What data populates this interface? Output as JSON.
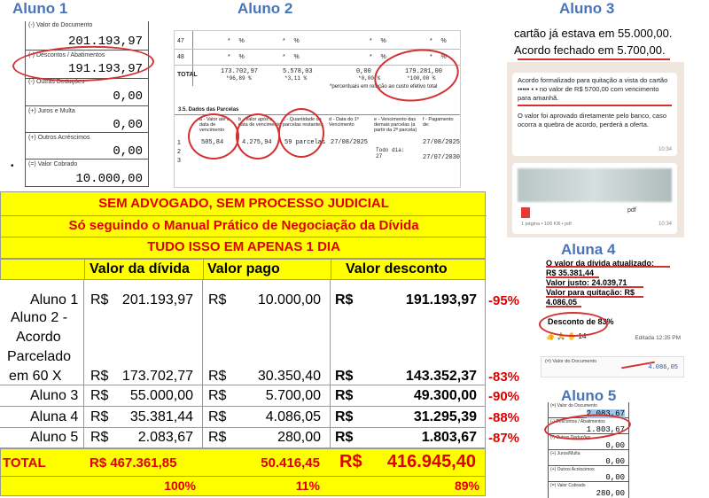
{
  "captions": {
    "aluno1": "Aluno 1",
    "aluno2": "Aluno 2",
    "aluno3": "Aluno 3",
    "aluna4": "Aluna 4",
    "aluno5": "Aluno 5"
  },
  "doc1": {
    "row0_label": "(-) Valor do Documento",
    "row0_value": "201.193,97",
    "row1_label": "(-) Descontos / Abatimentos",
    "row1_value": "191.193,97",
    "row2_label": "(-) Outras Deduções",
    "row2_value": "0,00",
    "row3_label": "(+) Juros e Multa",
    "row3_value": "0,00",
    "row4_label": "(+) Outros Acréscimos",
    "row4_value": "0,00",
    "row5_label": "(=) Valor Cobrado",
    "row5_value": "10.000,00"
  },
  "doc2": {
    "r47": "47",
    "r48": "48",
    "total_label": "TOTAL",
    "total_v1": "173.702,97",
    "total_p1": "*96,89 %",
    "total_v2": "5.578,03",
    "total_p2": "*3,11 %",
    "total_v3": "0,00",
    "total_p3": "*0,00 %",
    "total_v4": "179.281,00",
    "total_p4": "*100,00 %",
    "note": "*percentuais em relação ao custo efetivo total",
    "section": "3.5. Dados das Parcelas",
    "col_a": "a - Valor até a data de vencimento",
    "col_b": "b - Valor após a data de vencimento",
    "col_c": "c - Quantidade de parcelas restantes:",
    "col_d": "d - Data do 1º Vencimento",
    "col_e": "e - Vencimento das demais parcelas (a partir da 2ª parcela)",
    "col_f": "f - Pagamento de:",
    "row_num1": "1",
    "row_num2": "2",
    "row_num3": "3",
    "val_a": "505,84",
    "val_b": "4.275,94",
    "val_c": "59 parcelas",
    "val_d": "27/08/2025",
    "val_e": "Todo dia: 27",
    "val_f1": "27/08/2025",
    "val_f2": "27/07/2030"
  },
  "chat3": {
    "top_line1": "cartão já estava em 55.000,00.",
    "top_line2": "Acordo fechado em 5.700,00.",
    "msg1": "Acordo formalizado para quitação a vista do cartão ▪▪▪▪▪ ▪ ▪ no valor de R$ 5700,00 com vencimento para amanhã.",
    "time1": "10:34",
    "msg2": "O valor foi aprovado diretamente pelo banco, caso ocorra a quebra de acordo, perderá a oferta.",
    "time2": "10:34",
    "file_ext": "pdf",
    "file_info": "1 página • 106 KB • pdf",
    "time3": "10:34"
  },
  "chat4": {
    "line1": "O valor da dívida atualizado:",
    "line2": "R$ 35.381,44",
    "line3": "Valor justo: 24.039,71",
    "line4": "Valor para quitação: R$",
    "line5": "4.086,05",
    "line6": "Desconto de 83%",
    "reactions": "👍 🙏 ✋ 14",
    "edited": "Editada 12:35 PM",
    "doc_label": "(=) Valor do Documento",
    "doc_value": "4.086,05"
  },
  "doc5": {
    "r0_label": "(=) Valor do Documento",
    "r0_value": "2.083,67",
    "r1_label": "(-) Descontos / Abatimentos",
    "r1_value": "1.803,67",
    "r2_label": "(-) Outras Deduções",
    "r2_value": "0,00",
    "r3_label": "(+) Juros/Multa",
    "r3_value": "0,00",
    "r4_label": "(+) Outros Acréscimos",
    "r4_value": "0,00",
    "r5_label": "(=) Valor Cobrado",
    "r5_value": "280,00"
  },
  "banner": {
    "line1": "SEM ADVOGADO, SEM PROCESSO JUDICIAL",
    "line2": "Só seguindo o Manual Prático de Negociação da Dívida",
    "line3": "TUDO ISSO EM APENAS 1 DIA"
  },
  "table": {
    "headers": [
      "Valor da dívida",
      "Valor pago",
      "Valor desconto"
    ],
    "currency": "R$",
    "rows": [
      {
        "name": "Aluno 1",
        "debt": "201.193,97",
        "paid": "10.000,00",
        "discount": "191.193,97",
        "pct": "-95%"
      },
      {
        "name": "Aluno 2 - Acordo Parcelado em 60 X",
        "name_l1": "Aluno 2 -",
        "name_l2": "Acordo",
        "name_l3": "Parcelado",
        "name_l4": "em 60 X",
        "debt": "173.702,77",
        "paid": "30.350,40",
        "discount": "143.352,37",
        "pct": "-83%"
      },
      {
        "name": "Aluno 3",
        "debt": "55.000,00",
        "paid": "5.700,00",
        "discount": "49.300,00",
        "pct": "-90%"
      },
      {
        "name": "Aluna 4",
        "debt": "35.381,44",
        "paid": "4.086,05",
        "discount": "31.295,39",
        "pct": "-88%"
      },
      {
        "name": "Aluno 5",
        "debt": "2.083,67",
        "paid": "280,00",
        "discount": "1.803,67",
        "pct": "-87%"
      }
    ],
    "total": {
      "label": "TOTAL",
      "debt": "R$ 467.361,85",
      "paid": "50.416,45",
      "disc_currency": "R$",
      "discount": "416.945,40"
    },
    "percents": {
      "debt": "100%",
      "paid": "11%",
      "discount": "89%"
    }
  },
  "colors": {
    "accent_red": "#e00000",
    "highlight_yellow": "#ffff00",
    "caption_blue": "#4a74b8"
  }
}
